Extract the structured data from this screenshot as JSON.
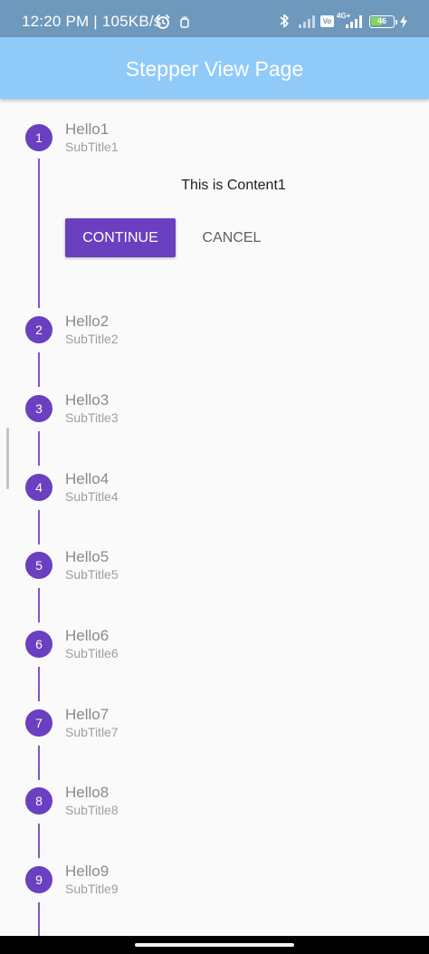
{
  "status_bar": {
    "time_speed": "12:20 PM | 105KB/s",
    "network_label": "4G+",
    "volte_label": "Vo",
    "battery": "46",
    "color": "#6f98bd"
  },
  "app_bar": {
    "title": "Stepper View Page",
    "color": "#90caf9"
  },
  "stepper": {
    "accent_color": "#6a3fc0",
    "steps": [
      {
        "number": "1",
        "title": "Hello1",
        "subtitle": "SubTitle1"
      },
      {
        "number": "2",
        "title": "Hello2",
        "subtitle": "SubTitle2"
      },
      {
        "number": "3",
        "title": "Hello3",
        "subtitle": "SubTitle3"
      },
      {
        "number": "4",
        "title": "Hello4",
        "subtitle": "SubTitle4"
      },
      {
        "number": "5",
        "title": "Hello5",
        "subtitle": "SubTitle5"
      },
      {
        "number": "6",
        "title": "Hello6",
        "subtitle": "SubTitle6"
      },
      {
        "number": "7",
        "title": "Hello7",
        "subtitle": "SubTitle7"
      },
      {
        "number": "8",
        "title": "Hello8",
        "subtitle": "SubTitle8"
      },
      {
        "number": "9",
        "title": "Hello9",
        "subtitle": "SubTitle9"
      }
    ],
    "active_content": "This is Content1",
    "continue_label": "CONTINUE",
    "cancel_label": "CANCEL"
  }
}
